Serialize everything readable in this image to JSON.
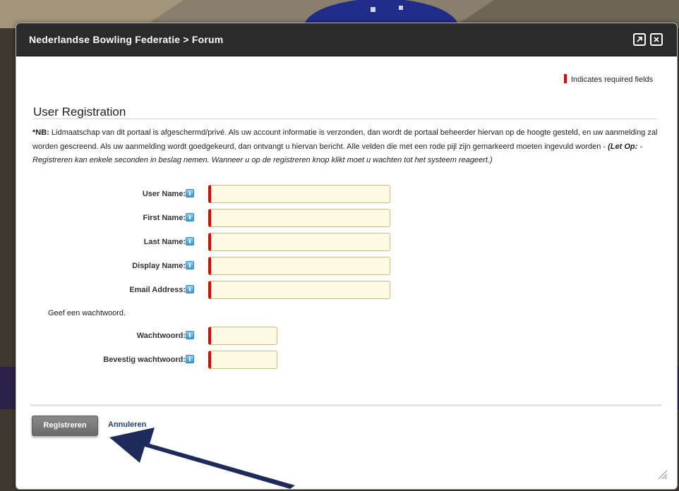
{
  "window": {
    "title": "Nederlandse Bowling Federatie > Forum"
  },
  "required_note": "Indicates required fields",
  "form": {
    "heading": "User Registration",
    "nb": {
      "prefix": "*NB:",
      "text": " Lidmaatschap van dit portaal is afgeschermd/privé. Als uw account informatie is verzonden, dan wordt de portaal beheerder hiervan op de hoogte gesteld, en uw aanmelding zal worden gescreend. Als uw aanmelding wordt goedgekeurd, dan ontvangt u hiervan bericht. Alle velden die met een rode pijl zijn gemarkeerd moeten ingevuld worden - ",
      "letop": "(Let Op:",
      "letop_text": " - Registreren kan enkele seconden in beslag nemen. Wanneer u op de registreren knop klikt moet u wachten tot het systeem reageert.)"
    },
    "fields": [
      {
        "label": "User Name:",
        "value": ""
      },
      {
        "label": "First Name:",
        "value": ""
      },
      {
        "label": "Last Name:",
        "value": ""
      },
      {
        "label": "Display Name:",
        "value": ""
      },
      {
        "label": "Email Address:",
        "value": ""
      }
    ],
    "password_intro": "Geef een wachtwoord.",
    "password_fields": [
      {
        "label": "Wachtwoord:",
        "value": ""
      },
      {
        "label": "Bevestig wachtwoord:",
        "value": ""
      }
    ],
    "register_label": "Registreren",
    "cancel_label": "Annuleren"
  },
  "colors": {
    "required": "#e00000",
    "input_bg": "#fffbe3",
    "titlebar": "#2b2b2b",
    "arrow": "#1e2a5a"
  },
  "icons": [
    "maximize-icon",
    "close-icon",
    "help-icon",
    "resize-grip-icon",
    "pointer-arrow"
  ]
}
